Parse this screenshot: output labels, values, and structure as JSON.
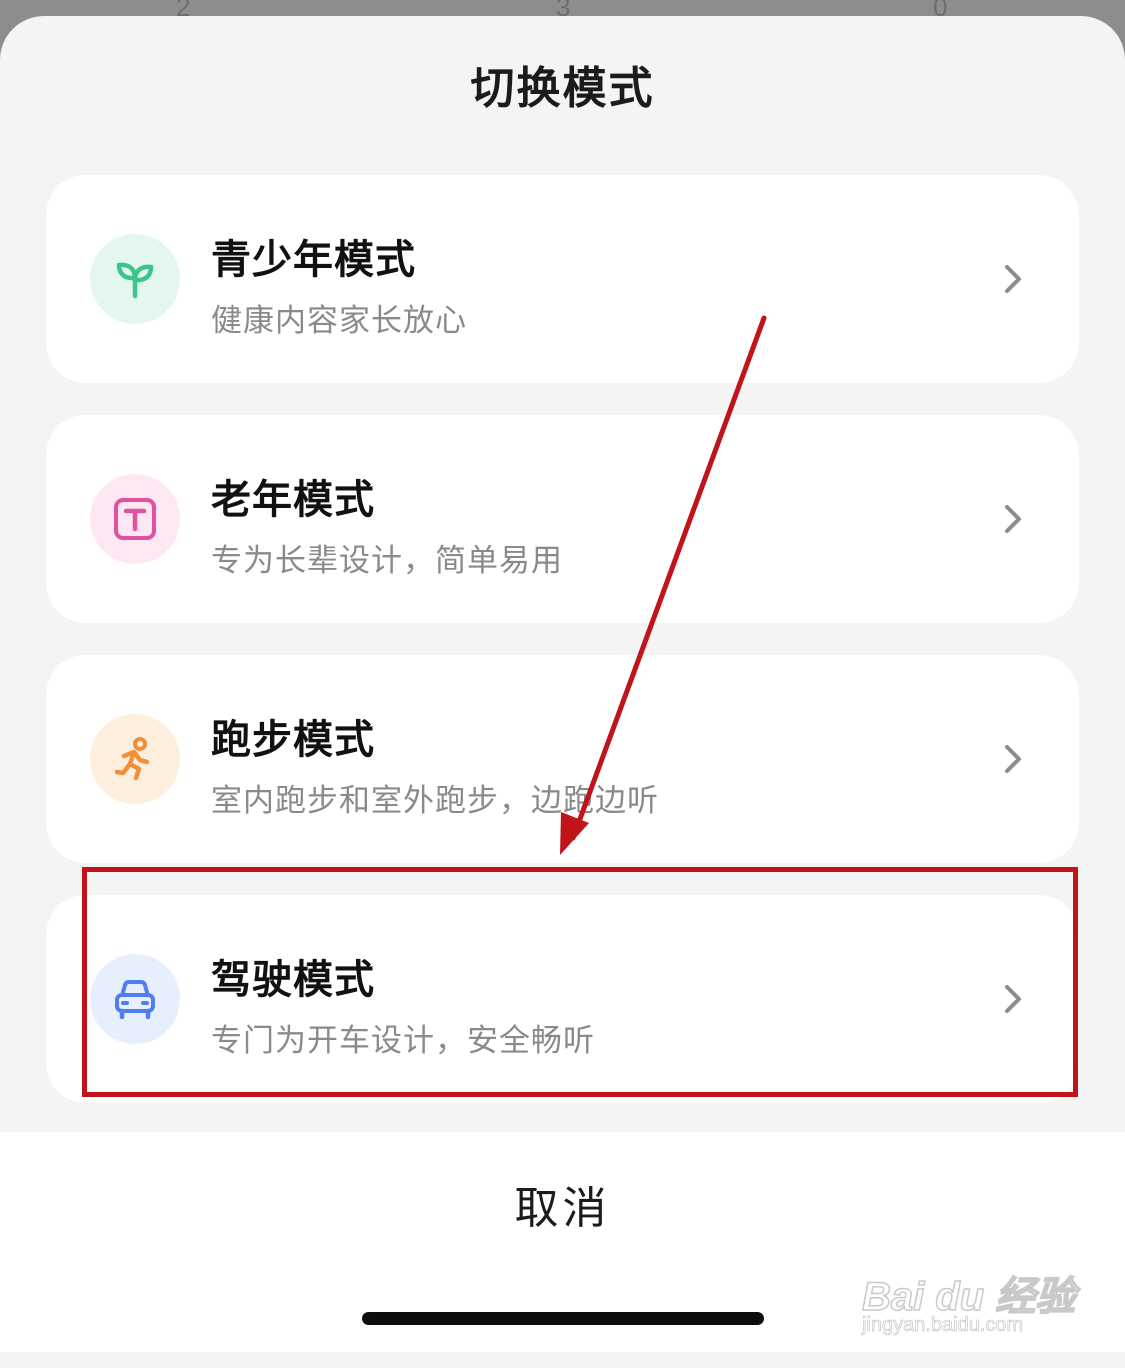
{
  "backdrop": {
    "numbers": [
      "2",
      "3",
      "0"
    ]
  },
  "sheet": {
    "title": "切换模式",
    "modes": [
      {
        "title": "青少年模式",
        "subtitle": "健康内容家长放心",
        "icon": "sprout-icon",
        "icon_bg": "#e3f7ee",
        "icon_color": "#3cc58a"
      },
      {
        "title": "老年模式",
        "subtitle": "专为长辈设计，简单易用",
        "icon": "text-t-icon",
        "icon_bg": "#fde7f3",
        "icon_color": "#e0529f"
      },
      {
        "title": "跑步模式",
        "subtitle": "室内跑步和室外跑步，边跑边听",
        "icon": "running-icon",
        "icon_bg": "#fdeede",
        "icon_color": "#f0913a"
      },
      {
        "title": "驾驶模式",
        "subtitle": "专门为开车设计，安全畅听",
        "icon": "car-icon",
        "icon_bg": "#e7eefc",
        "icon_color": "#4f7ef0"
      }
    ],
    "cancel_label": "取消"
  },
  "annotation": {
    "color": "#c0141a"
  },
  "watermark": {
    "brand": "Bai du 经验",
    "url": "jingyan.baidu.com"
  }
}
